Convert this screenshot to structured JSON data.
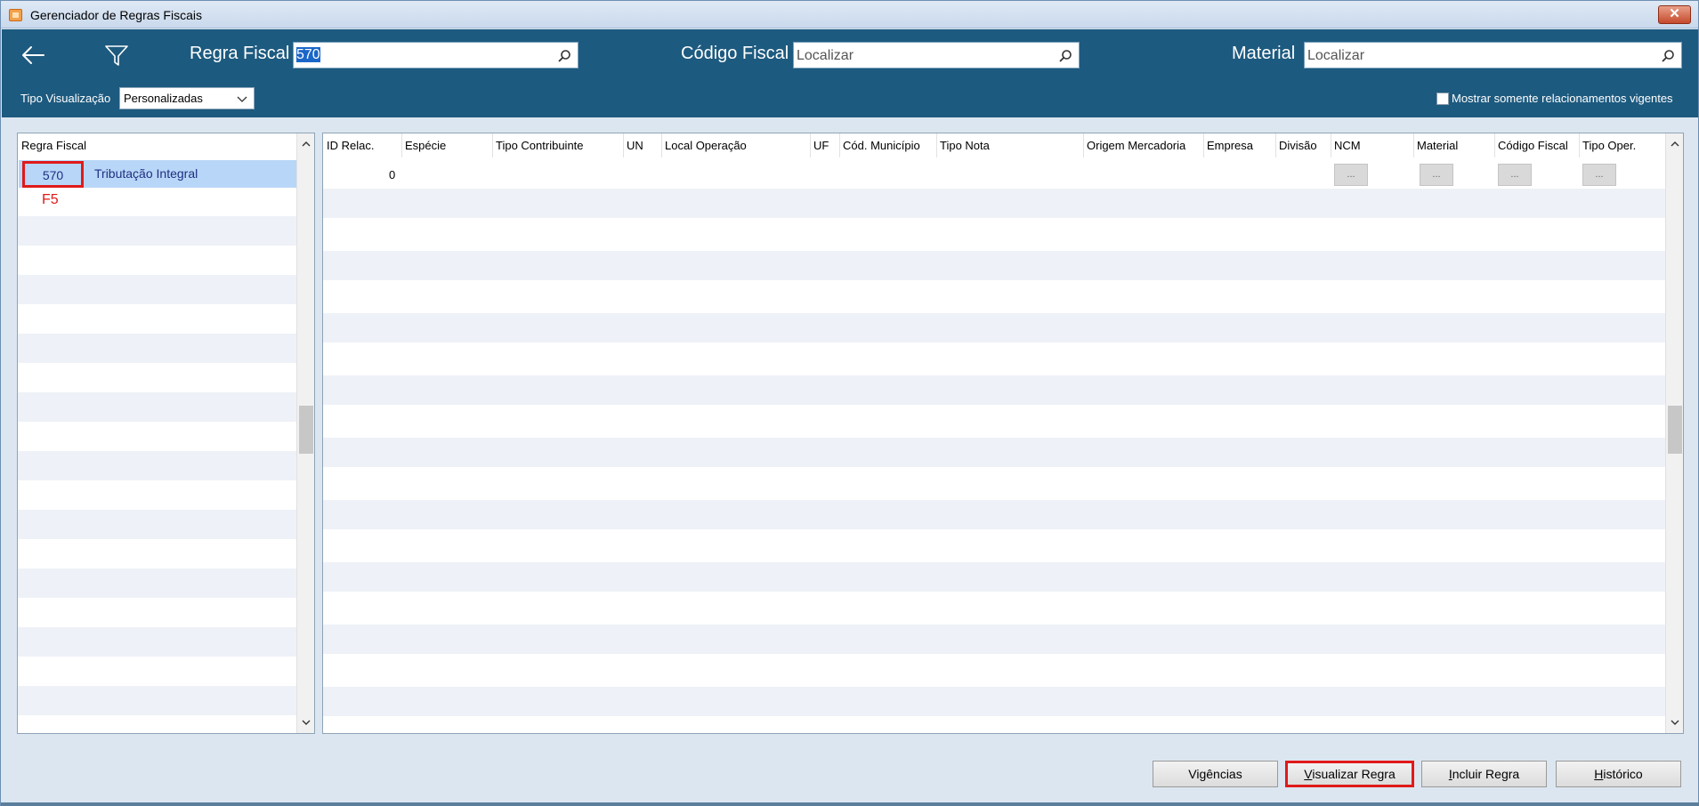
{
  "window": {
    "title": "Gerenciador de Regras Fiscais",
    "close_label": "✕"
  },
  "header": {
    "regra_fiscal_label": "Regra Fiscal",
    "regra_fiscal_value": "570",
    "codigo_fiscal_label": "Código Fiscal",
    "codigo_fiscal_placeholder": "Localizar",
    "material_label": "Material",
    "material_placeholder": "Localizar",
    "tipo_visualizacao_label": "Tipo Visualização",
    "tipo_visualizacao_value": "Personalizadas",
    "vigentes_label": "Mostrar somente relacionamentos vigentes",
    "vigentes_checked": false
  },
  "left_grid": {
    "header": "Regra Fiscal",
    "rows": [
      {
        "code": "570",
        "description": "Tributação Integral",
        "selected": true
      }
    ],
    "annotation": "F5"
  },
  "right_grid": {
    "columns": [
      "ID Relac.",
      "Espécie",
      "Tipo Contribuinte",
      "UN",
      "Local Operação",
      "UF",
      "Cód. Município",
      "Tipo Nota",
      "Origem Mercadoria",
      "Empresa",
      "Divisão",
      "NCM",
      "Material",
      "Código Fiscal",
      "Tipo Oper."
    ],
    "rows": [
      {
        "id_relac": "0",
        "ncm": "...",
        "material": "...",
        "codigo_fiscal": "...",
        "tipo_oper": "..."
      }
    ]
  },
  "buttons": {
    "vigencias": "Vigências",
    "visualizar_regra_key": "V",
    "visualizar_regra_rest": "isualizar Regra",
    "incluir_regra_key": "I",
    "incluir_regra_rest": "ncluir Regra",
    "historico_key": "H",
    "historico_rest": "istórico"
  },
  "colors": {
    "header_bg": "#1d5a7f",
    "selected_row": "#b8d6f7",
    "highlight_red": "#e01a1a",
    "alt_row": "#eef1f7"
  }
}
